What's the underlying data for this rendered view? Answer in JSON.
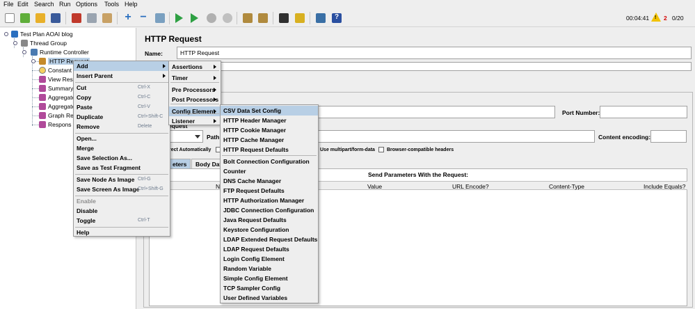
{
  "menubar": [
    "File",
    "Edit",
    "Search",
    "Run",
    "Options",
    "Tools",
    "Help"
  ],
  "toolbar": {
    "buttons": [
      "new-icon",
      "templates-icon",
      "open-icon",
      "save-icon",
      "cut-icon",
      "copy-icon",
      "paste-icon",
      "expand-icon",
      "collapse-icon",
      "toggle-icon",
      "start-icon",
      "start-no-pause-icon",
      "stop-icon",
      "shutdown-icon",
      "clear-icon",
      "clear-all-icon",
      "search-icon",
      "reset-search-icon",
      "function-helper-icon",
      "help-icon"
    ],
    "timer": "00:04:41",
    "warning_count": "2",
    "threads": "0/20"
  },
  "tree": {
    "nodes": [
      {
        "label": "Test Plan AOAI blog",
        "icon": "test-plan-icon"
      },
      {
        "label": "Thread Group",
        "icon": "thread-group-icon"
      },
      {
        "label": "Runtime Controller",
        "icon": "controller-icon"
      },
      {
        "label": "HTTP Request",
        "icon": "sampler-icon"
      },
      {
        "label": "Constant",
        "icon": "timer-icon"
      },
      {
        "label": "View Resu",
        "icon": "listener-icon"
      },
      {
        "label": "Summary",
        "icon": "listener-icon"
      },
      {
        "label": "Aggregate",
        "icon": "listener-icon"
      },
      {
        "label": "Aggregate",
        "icon": "listener-icon"
      },
      {
        "label": "Graph Re",
        "icon": "listener-icon"
      },
      {
        "label": "Respons",
        "icon": "listener-icon"
      }
    ]
  },
  "panel": {
    "title": "HTTP Request",
    "name_label": "Name:",
    "name_value": "HTTP Request",
    "port_label": "Port Number:",
    "request_label": "equest",
    "path_label": "Path:",
    "encoding_label": "Content encoding:",
    "redirect_label": "rect Automatically",
    "multipart_label": "Use multipart/form-data",
    "browser_label": "Browser-compatible headers",
    "tab_params": "eters",
    "tab_body": "Body Data",
    "params_title": "Send Parameters With the Request:",
    "columns": [
      "N",
      "Value",
      "URL Encode?",
      "Content-Type",
      "Include Equals?"
    ]
  },
  "context_menu": {
    "items": [
      {
        "label": "Add",
        "shortcut": "",
        "submenu": true,
        "selected": true
      },
      {
        "label": "Insert Parent",
        "shortcut": "",
        "submenu": true
      },
      {
        "sep": true
      },
      {
        "label": "Cut",
        "shortcut": "Ctrl-X"
      },
      {
        "label": "Copy",
        "shortcut": "Ctrl-C"
      },
      {
        "label": "Paste",
        "shortcut": "Ctrl-V"
      },
      {
        "label": "Duplicate",
        "shortcut": "Ctrl+Shift-C"
      },
      {
        "label": "Remove",
        "shortcut": "Delete"
      },
      {
        "sep": true
      },
      {
        "label": "Open...",
        "shortcut": ""
      },
      {
        "label": "Merge",
        "shortcut": ""
      },
      {
        "label": "Save Selection As...",
        "shortcut": ""
      },
      {
        "label": "Save as Test Fragment",
        "shortcut": ""
      },
      {
        "sep": true
      },
      {
        "label": "Save Node As Image",
        "shortcut": "Ctrl-G"
      },
      {
        "label": "Save Screen As Image",
        "shortcut": "Ctrl+Shift-G"
      },
      {
        "sep": true
      },
      {
        "label": "Enable",
        "shortcut": "",
        "disabled": true
      },
      {
        "label": "Disable",
        "shortcut": ""
      },
      {
        "label": "Toggle",
        "shortcut": "Ctrl-T"
      },
      {
        "sep": true
      },
      {
        "label": "Help",
        "shortcut": ""
      }
    ]
  },
  "add_menu": {
    "items": [
      {
        "label": "Assertions",
        "submenu": true
      },
      {
        "label": "Timer",
        "submenu": true
      },
      {
        "label": "Pre Processors",
        "submenu": true
      },
      {
        "label": "Post Processors",
        "submenu": true
      },
      {
        "label": "Config Element",
        "submenu": true,
        "selected": true
      },
      {
        "label": "Listener",
        "submenu": true
      }
    ]
  },
  "config_menu": {
    "items": [
      "CSV Data Set Config",
      "HTTP Header Manager",
      "HTTP Cookie Manager",
      "HTTP Cache Manager",
      "HTTP Request Defaults",
      "Bolt Connection Configuration",
      "Counter",
      "DNS Cache Manager",
      "FTP Request Defaults",
      "HTTP Authorization Manager",
      "JDBC Connection Configuration",
      "Java Request Defaults",
      "Keystore Configuration",
      "LDAP Extended Request Defaults",
      "LDAP Request Defaults",
      "Login Config Element",
      "Random Variable",
      "Simple Config Element",
      "TCP Sampler Config",
      "User Defined Variables"
    ]
  },
  "colors": {
    "selection": "#b8cfe5",
    "warning": "#d40000"
  }
}
